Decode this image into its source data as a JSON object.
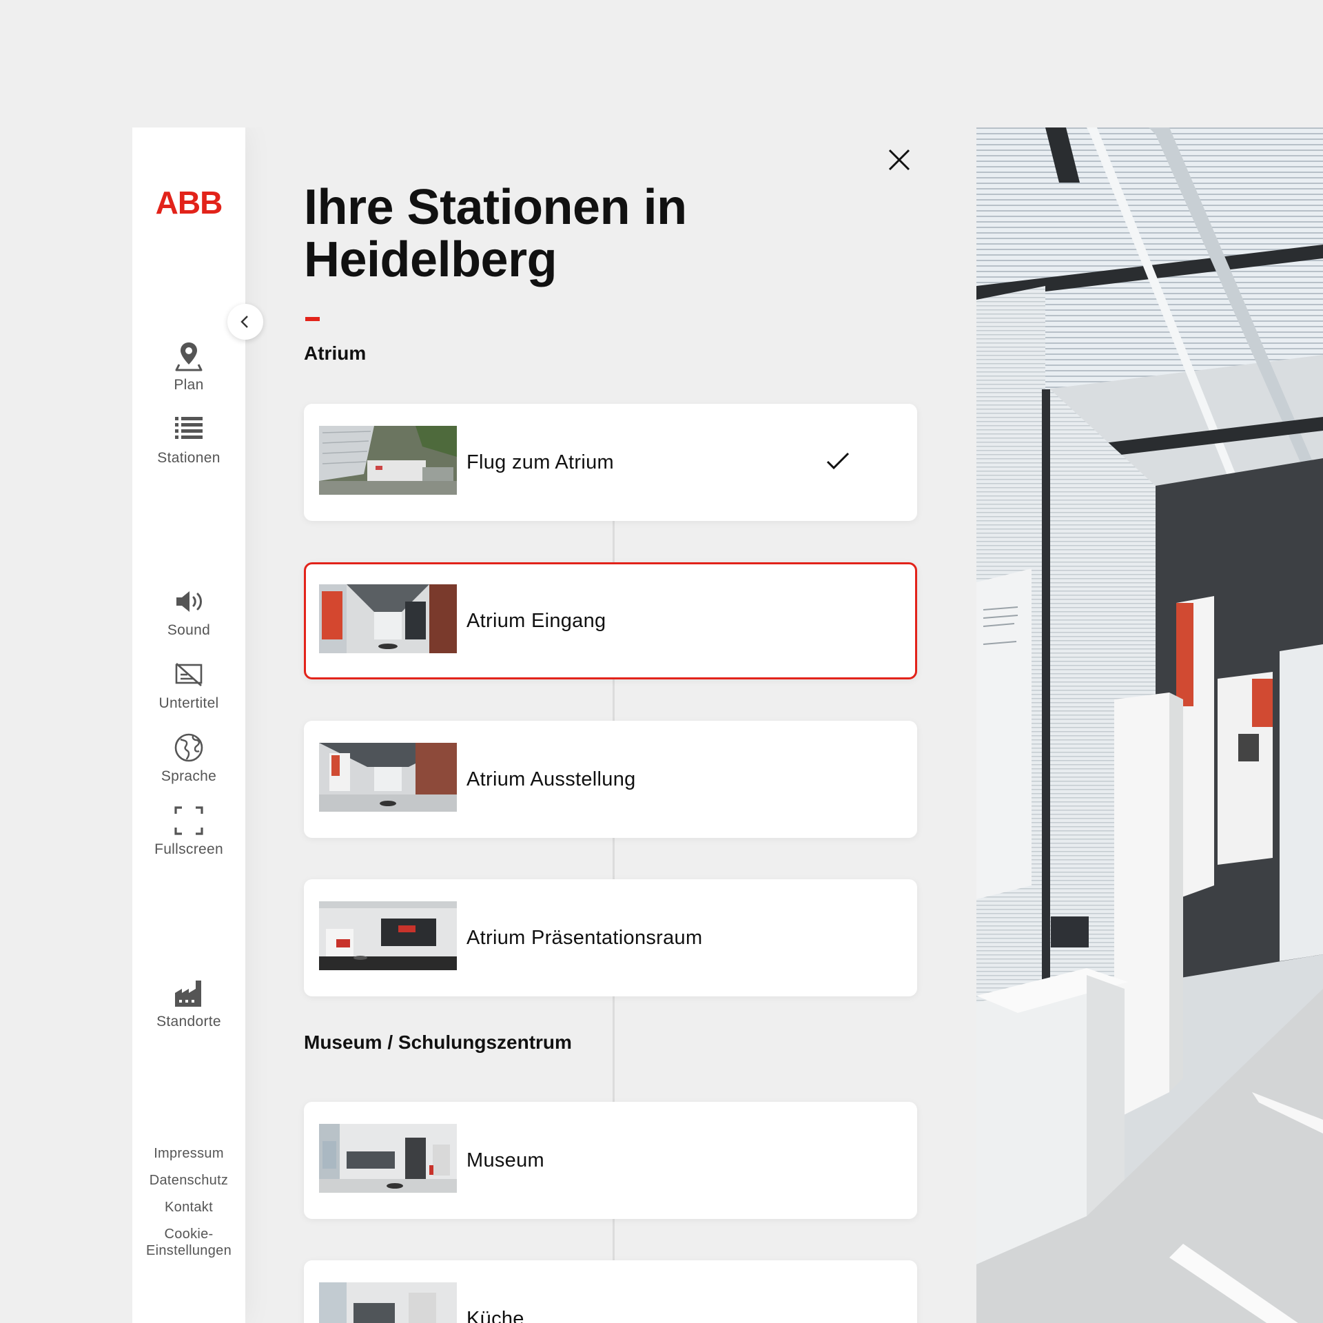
{
  "brand": {
    "logo_text": "ABB",
    "accent_color": "#e2231a"
  },
  "sidebar": {
    "nav": [
      {
        "id": "plan",
        "label": "Plan",
        "icon": "map-pin-icon"
      },
      {
        "id": "stationen",
        "label": "Stationen",
        "icon": "list-icon"
      },
      {
        "id": "sound",
        "label": "Sound",
        "icon": "speaker-icon"
      },
      {
        "id": "untertitel",
        "label": "Untertitel",
        "icon": "subtitles-off-icon"
      },
      {
        "id": "sprache",
        "label": "Sprache",
        "icon": "globe-icon"
      },
      {
        "id": "fullscreen",
        "label": "Fullscreen",
        "icon": "fullscreen-icon"
      },
      {
        "id": "standorte",
        "label": "Standorte",
        "icon": "factory-icon"
      }
    ],
    "footer_links": [
      "Impressum",
      "Datenschutz",
      "Kontakt",
      "Cookie-\nEinstellungen"
    ]
  },
  "panel": {
    "title_line1": "Ihre Stationen in",
    "title_line2": "Heidelberg",
    "sections": [
      {
        "name": "Atrium",
        "stations": [
          {
            "label": "Flug zum Atrium",
            "visited": true,
            "active": false
          },
          {
            "label": "Atrium Eingang",
            "visited": false,
            "active": true
          },
          {
            "label": "Atrium Ausstellung",
            "visited": false,
            "active": false
          },
          {
            "label": "Atrium Präsentationsraum",
            "visited": false,
            "active": false
          }
        ]
      },
      {
        "name": "Museum / Schulungszentrum",
        "stations": [
          {
            "label": "Museum",
            "visited": false,
            "active": false
          },
          {
            "label": "Küche",
            "visited": false,
            "active": false
          }
        ]
      }
    ]
  }
}
